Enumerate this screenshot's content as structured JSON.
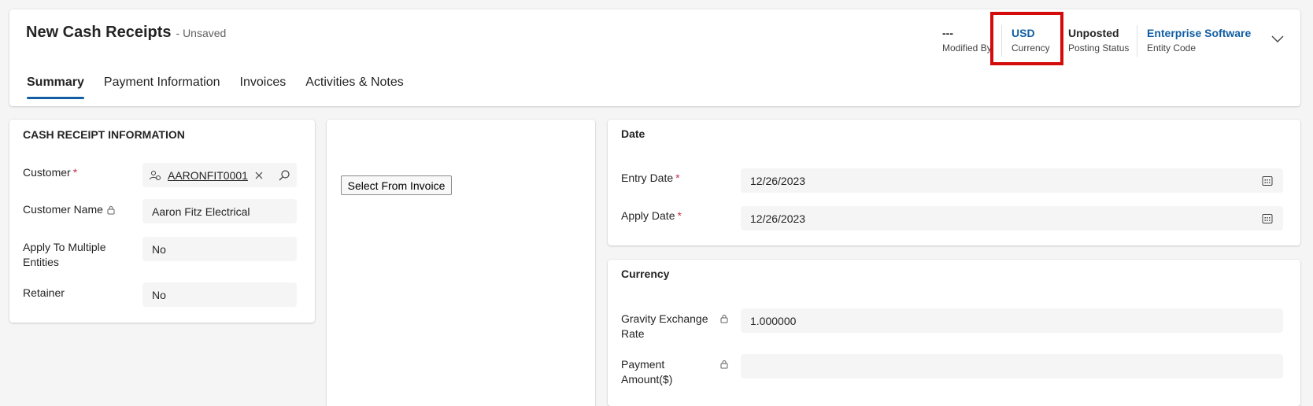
{
  "header": {
    "title": "New Cash Receipts",
    "unsaved": "- Unsaved",
    "modified_by_value": "---",
    "modified_by_label": "Modified By",
    "currency_value": "USD",
    "currency_label": "Currency",
    "posting_status_value": "Unposted",
    "posting_status_label": "Posting Status",
    "entity_code_value": "Enterprise Software",
    "entity_code_label": "Entity Code",
    "highlight_color": "#d40b0b"
  },
  "tabs": [
    {
      "label": "Summary",
      "active": true
    },
    {
      "label": "Payment Information",
      "active": false
    },
    {
      "label": "Invoices",
      "active": false
    },
    {
      "label": "Activities & Notes",
      "active": false
    }
  ],
  "cash_receipt": {
    "section_title": "CASH RECEIPT INFORMATION",
    "customer_label": "Customer",
    "required_mark": "*",
    "customer_value": "AARONFIT0001",
    "customer_name_label": "Customer Name",
    "customer_name_value": "Aaron Fitz Electrical",
    "apply_multiple_label_1": "Apply To Multiple",
    "apply_multiple_label_2": "Entities",
    "apply_multiple_value": "No",
    "retainer_label": "Retainer",
    "retainer_value": "No"
  },
  "middle": {
    "select_button": "Select From Invoice"
  },
  "date_section": {
    "title": "Date",
    "entry_date_label": "Entry Date",
    "entry_date_value": "12/26/2023",
    "apply_date_label": "Apply Date",
    "apply_date_value": "12/26/2023"
  },
  "currency_section": {
    "title": "Currency",
    "exchange_label_1": "Gravity Exchange",
    "exchange_label_2": "Rate",
    "exchange_value": "1.000000",
    "payment_label_1": "Payment",
    "payment_label_2": "Amount($)",
    "payment_value": ""
  },
  "colors": {
    "accent": "#115ea3",
    "required": "#c4314b",
    "field_bg": "#f5f5f5"
  }
}
